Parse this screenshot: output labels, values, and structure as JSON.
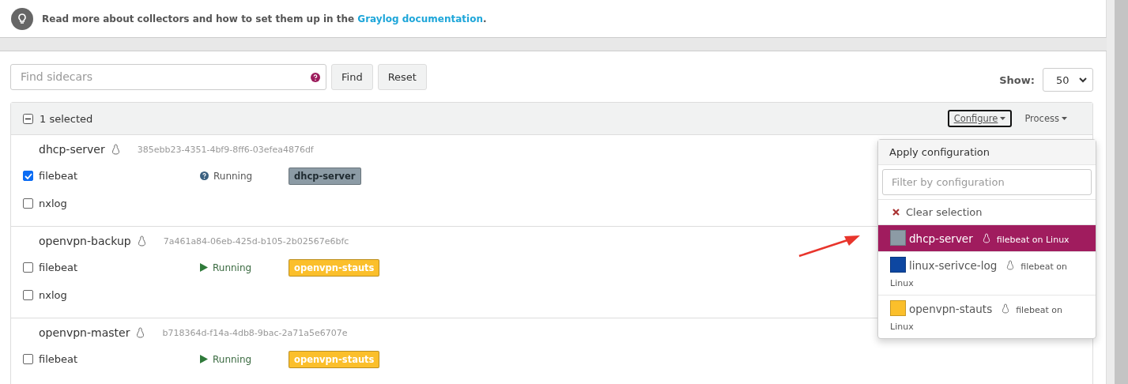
{
  "info": {
    "text": "Read more about collectors and how to set them up in the ",
    "link": "Graylog documentation",
    "end": "."
  },
  "search": {
    "placeholder": "Find sidecars",
    "buttons": [
      "Find",
      "Reset"
    ]
  },
  "show": {
    "label": "Show:",
    "value": "50"
  },
  "bulk": {
    "kind": "partial",
    "label": "1 selected",
    "actions": [
      {
        "label": "Configure",
        "focused": true
      },
      {
        "label": "Process",
        "focused": false
      }
    ]
  },
  "sidecars": [
    {
      "name": "dhcp-server",
      "id": "385ebb23-4351-4bf9-8ff6-03efea4876df",
      "collectors": [
        {
          "name": "filebeat",
          "checked": true,
          "status": "Running",
          "kind": "unknown",
          "tag": "dhcp-server",
          "color": "#8c9ba5"
        },
        {
          "name": "nxlog",
          "checked": false
        }
      ]
    },
    {
      "name": "openvpn-backup",
      "id": "7a461a84-06eb-425d-b105-2b02567e6bfc",
      "collectors": [
        {
          "name": "filebeat",
          "checked": false,
          "status": "Running",
          "kind": "running",
          "tag": "openvpn-stauts",
          "color": "#fbbf2b"
        },
        {
          "name": "nxlog",
          "checked": false
        }
      ]
    },
    {
      "name": "openvpn-master",
      "id": "b718364d-f14a-4db8-9bac-2a71a5e6707e",
      "collectors": [
        {
          "name": "filebeat",
          "checked": false,
          "status": "Running",
          "kind": "running",
          "tag": "openvpn-stauts",
          "color": "#fbbf2b"
        }
      ]
    }
  ],
  "dropdown": {
    "title": "Apply configuration",
    "filter_placeholder": "Filter by configuration",
    "clear": "Clear selection",
    "items": [
      {
        "name": "dhcp-server",
        "color": "#8c9ba5",
        "detail": "filebeat on Linux",
        "selected": true
      },
      {
        "name": "linux-serivce-log",
        "color": "#0d47a1",
        "detail": "filebeat on Linux",
        "selected": false
      },
      {
        "name": "openvpn-stauts",
        "color": "#fbbf2b",
        "detail": "filebeat on Linux",
        "selected": false
      }
    ]
  }
}
